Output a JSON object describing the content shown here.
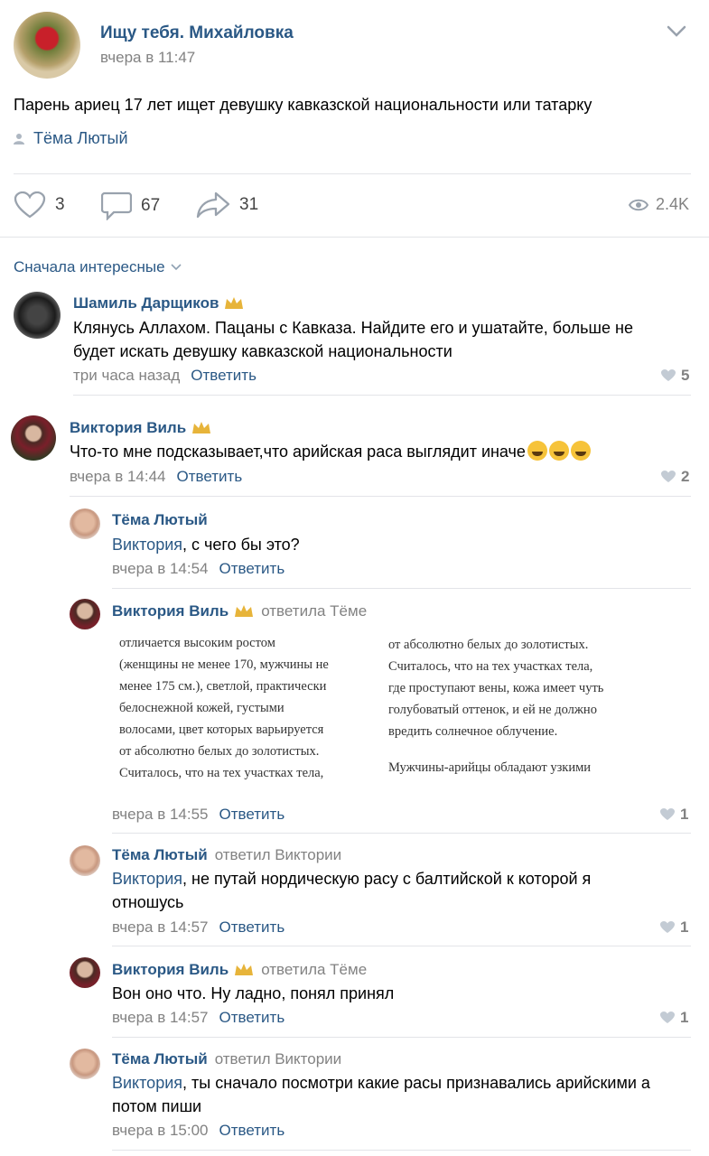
{
  "post": {
    "title": "Ищу тебя. Михайловка",
    "time": "вчера в 11:47",
    "text": "Парень ариец 17 лет ищет девушку кавказской национальности или татарку",
    "author": "Тёма Лютый",
    "likes": "3",
    "comments": "67",
    "shares": "31",
    "views": "2.4K"
  },
  "sort_label": "Сначала интересные",
  "reply_label": "Ответить",
  "comments": [
    {
      "name": "Шамиль Дарщиков",
      "text": "Клянусь Аллахом. Пацаны с Кавказа. Найдите его и ушатайте, больше не будет искать девушку кавказской национальности",
      "time": "три часа назад",
      "likes": "5"
    },
    {
      "name": "Виктория Виль",
      "text": "Что-то мне подсказывает,что арийская раса выглядит иначе",
      "time": "вчера в 14:44",
      "likes": "2"
    }
  ],
  "replies": [
    {
      "name": "Тёма Лютый",
      "addressee": "Виктория",
      "text": ", с чего бы это?",
      "time": "вчера в 14:54"
    },
    {
      "name": "Виктория Виль",
      "replied_to": "ответила Тёме",
      "time": "вчера в 14:55",
      "likes": "1",
      "image_text_left": [
        "отличается высоким ростом",
        "(женщины не менее 170, мужчины не",
        "менее 175 см.), светлой, практически",
        "белоснежной кожей, густыми",
        "волосами, цвет которых варьируется",
        "от абсолютно белых до золотистых.",
        "Считалось, что на тех участках тела,"
      ],
      "image_text_right": [
        "от абсолютно белых до золотистых.",
        "Считалось, что на тех участках тела,",
        "где проступают вены, кожа имеет чуть",
        "голубоватый оттенок, и ей не должно",
        "вредить солнечное облучение.",
        "",
        "Мужчины-арийцы обладают узкими"
      ]
    },
    {
      "name": "Тёма Лютый",
      "replied_to": "ответил Виктории",
      "addressee": "Виктория",
      "text": ", не путай нордическую расу с балтийской к которой я отношусь",
      "time": "вчера в 14:57",
      "likes": "1"
    },
    {
      "name": "Виктория Виль",
      "replied_to": "ответила Тёме",
      "text": "Вон оно что. Ну ладно, понял принял",
      "time": "вчера в 14:57",
      "likes": "1"
    },
    {
      "name": "Тёма Лютый",
      "replied_to": "ответил Виктории",
      "addressee": "Виктория",
      "text": ", ты сначало посмотри какие расы признавались арийскими а потом пиши",
      "time": "вчера в 15:00"
    }
  ],
  "colors": {
    "link": "#2a5885",
    "muted": "#828282",
    "divider": "#e3e4e8"
  },
  "icons": [
    "chevron-down-icon",
    "person-icon",
    "heart-icon",
    "comment-icon",
    "share-icon",
    "eye-icon",
    "crown-icon"
  ]
}
